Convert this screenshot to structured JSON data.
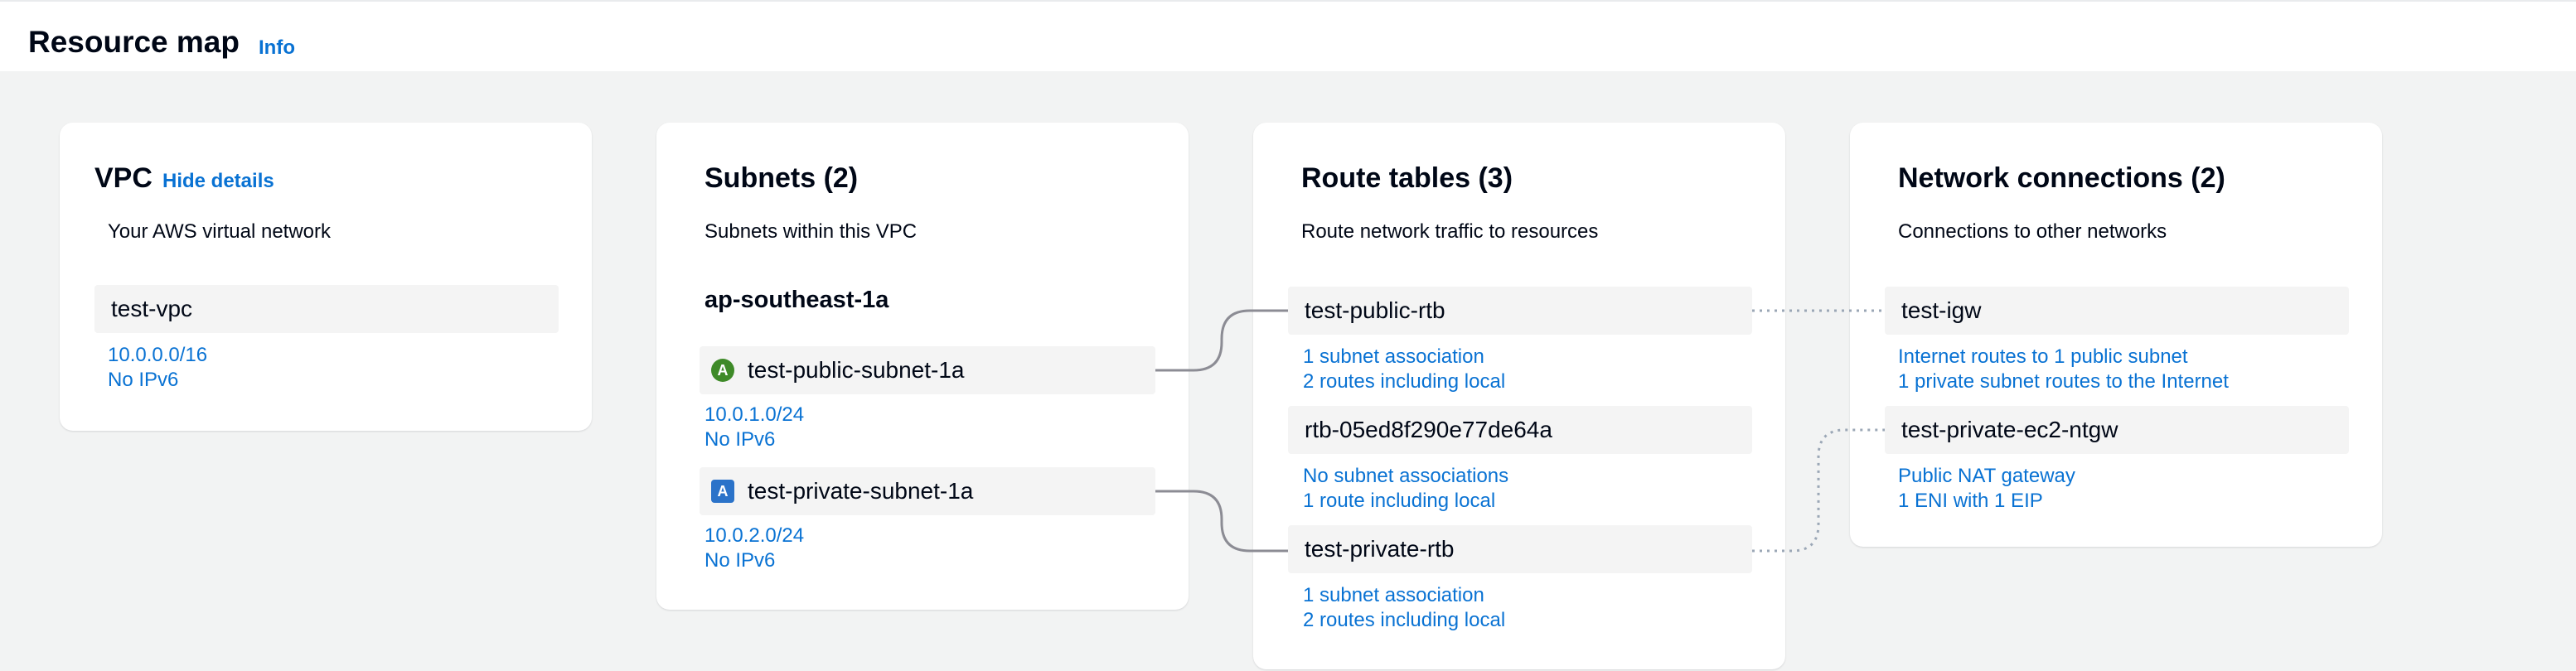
{
  "header": {
    "title": "Resource map",
    "info_label": "Info"
  },
  "vpc": {
    "title": "VPC",
    "hide_details_label": "Hide details",
    "subtitle": "Your AWS virtual network",
    "name": "test-vpc",
    "cidr": "10.0.0.0/16",
    "ipv6": "No IPv6"
  },
  "subnets": {
    "title": "Subnets (2)",
    "subtitle": "Subnets within this VPC",
    "az": "ap-southeast-1a",
    "items": [
      {
        "name": "test-public-subnet-1a",
        "badge": "A",
        "badge_shape": "circle",
        "badge_color": "#3e8a28",
        "cidr": "10.0.1.0/24",
        "ipv6": "No IPv6"
      },
      {
        "name": "test-private-subnet-1a",
        "badge": "A",
        "badge_shape": "square",
        "badge_color": "#2b73c9",
        "cidr": "10.0.2.0/24",
        "ipv6": "No IPv6"
      }
    ]
  },
  "route_tables": {
    "title": "Route tables (3)",
    "subtitle": "Route network traffic to resources",
    "items": [
      {
        "name": "test-public-rtb",
        "associations": "1 subnet association",
        "routes": "2 routes including local"
      },
      {
        "name": "rtb-05ed8f290e77de64a",
        "associations": "No subnet associations",
        "routes": "1 route including local"
      },
      {
        "name": "test-private-rtb",
        "associations": "1 subnet association",
        "routes": "2 routes including local"
      }
    ]
  },
  "network_connections": {
    "title": "Network connections (2)",
    "subtitle": "Connections to other networks",
    "items": [
      {
        "name": "test-igw",
        "line1": "Internet routes to 1 public subnet",
        "line2": "1 private subnet routes to the Internet"
      },
      {
        "name": "test-private-ec2-ntgw",
        "line1": "Public NAT gateway",
        "line2": "1 ENI with 1 EIP"
      }
    ]
  },
  "colors": {
    "link": "#0972d3",
    "background": "#f2f3f3",
    "card": "#ffffff",
    "resource_box": "#f4f4f4",
    "connector_solid": "#8c8c94",
    "connector_dotted": "#9ba7b6"
  }
}
